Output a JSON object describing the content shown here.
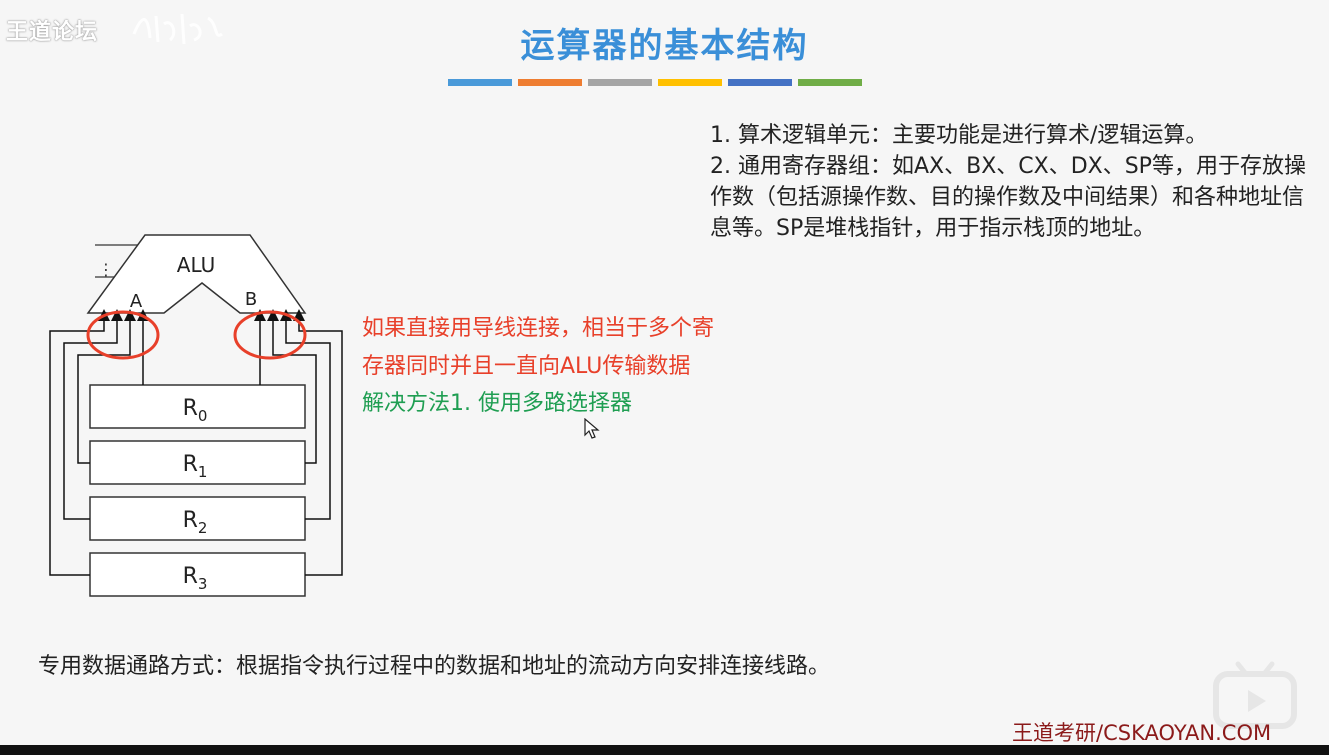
{
  "watermark": {
    "text": "王道论坛"
  },
  "slide": {
    "title": "运算器的基本结构",
    "accent_colors": [
      "#4a9ad9",
      "#ee7d31",
      "#a5a5a5",
      "#ffc000",
      "#4472c4",
      "#70ad47"
    ]
  },
  "info": {
    "line1": "1. 算术逻辑单元：主要功能是进行算术/逻辑运算。",
    "line2": "2. 通用寄存器组：如AX、BX、CX、DX、SP等，用于存放操作数（包括源操作数、目的操作数及中间结果）和各种地址信息等。SP是堆栈指针，用于指示栈顶的地址。"
  },
  "notes": {
    "red_line1": "如果直接用导线连接，相当于多个寄",
    "red_line2": "存器同时并且一直向ALU传输数据",
    "green": "解决方法1. 使用多路选择器"
  },
  "diagram": {
    "alu_label": "ALU",
    "port_a": "A",
    "port_b": "B",
    "dots": "⋮",
    "registers": [
      {
        "base": "R",
        "sub": "0"
      },
      {
        "base": "R",
        "sub": "1"
      },
      {
        "base": "R",
        "sub": "2"
      },
      {
        "base": "R",
        "sub": "3"
      }
    ],
    "highlight_color": "#e8402a"
  },
  "bottom": {
    "text": "专用数据通路方式：根据指令执行过程中的数据和地址的流动方向安排连接线路。"
  },
  "footer": {
    "brand": "王道考研/CSKAOYAN.COM"
  }
}
